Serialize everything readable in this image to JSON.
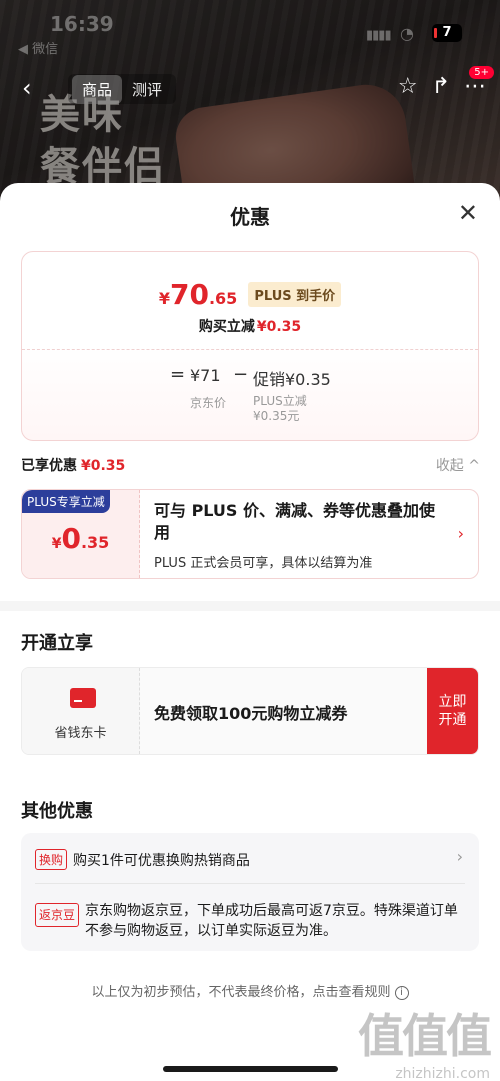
{
  "status_bar": {
    "time": "16:39",
    "back_app": "◀ 微信",
    "battery": "7"
  },
  "background": {
    "headline_line1": "美味",
    "headline_line2": "餐伴侣"
  },
  "navbar": {
    "tabs": [
      {
        "label": "商品"
      },
      {
        "label": "测评"
      }
    ],
    "badge": "5+"
  },
  "sheet": {
    "title": "优惠",
    "price_card": {
      "currency": "¥",
      "price_int": "70",
      "price_dec": ".65",
      "plus_tag": "PLUS 到手价",
      "save_label": "购买立减",
      "save_amount": "¥0.35",
      "formula": {
        "equals": "=",
        "base_price": "¥71",
        "base_label": "京东价",
        "minus": "−",
        "promo": "促销¥0.35",
        "promo_label_line1": "PLUS立减",
        "promo_label_line2": "¥0.35元"
      }
    },
    "enjoyed": {
      "label": "已享优惠",
      "amount": "¥0.35",
      "collapse": "收起 ^"
    },
    "plus_card": {
      "badge": "PLUS专享立减",
      "currency": "¥",
      "amount_int": "0",
      "amount_dec": ".35",
      "desc": "可与 PLUS 价、满减、券等优惠叠加使用",
      "sub": "PLUS 正式会员可享，具体以结算为准"
    },
    "open_section": {
      "title": "开通立享",
      "card_label": "省钱东卡",
      "text": "免费领取100元购物立减券",
      "button_line1": "立即",
      "button_line2": "开通"
    },
    "other_section": {
      "title": "其他优惠",
      "items": [
        {
          "tag": "换购",
          "text": "购买1件可优惠换购热销商品"
        },
        {
          "tag": "返京豆",
          "text": "京东购物返京豆，下单成功后最高可返7京豆。特殊渠道订单不参与购物返豆，以订单实际返豆为准。"
        }
      ]
    },
    "footnote": "以上仅为初步预估，不代表最终价格，点击查看规则"
  },
  "watermark": {
    "big": "值值值",
    "small": "zhizhizhi.com"
  },
  "colors": {
    "accent": "#e0252b",
    "plus_blue": "#2c3e9b",
    "plus_gold": "#fbeccf"
  }
}
